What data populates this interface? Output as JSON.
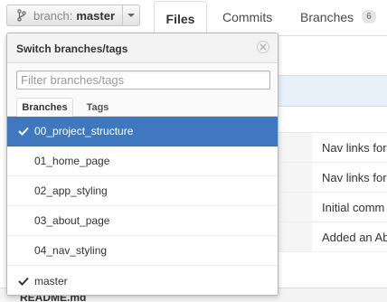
{
  "branch_button": {
    "label": "branch:",
    "value": "master",
    "icon": "branch-icon"
  },
  "nav_tabs": {
    "files": "Files",
    "commits": "Commits",
    "branches": "Branches",
    "branches_count": "6"
  },
  "file_rows": [
    {
      "message": "Nav links for"
    },
    {
      "message": "Nav links for"
    },
    {
      "message": "Initial comm"
    },
    {
      "message": "Added an Ab"
    }
  ],
  "readme": {
    "title": "README.md"
  },
  "dropdown": {
    "title": "Switch branches/tags",
    "filter": {
      "placeholder": "Filter branches/tags",
      "value": ""
    },
    "tabs": {
      "branches": "Branches",
      "tags": "Tags",
      "active": "Branches"
    },
    "items": [
      {
        "name": "00_project_structure",
        "checked": true,
        "selected": true
      },
      {
        "name": "01_home_page",
        "checked": false,
        "selected": false
      },
      {
        "name": "02_app_styling",
        "checked": false,
        "selected": false
      },
      {
        "name": "03_about_page",
        "checked": false,
        "selected": false
      },
      {
        "name": "04_nav_styling",
        "checked": false,
        "selected": false
      },
      {
        "name": "master",
        "checked": true,
        "selected": false
      }
    ]
  },
  "colors": {
    "selected_bg": "#4078c0",
    "commit_bar_bg": "#e8f1fa"
  }
}
